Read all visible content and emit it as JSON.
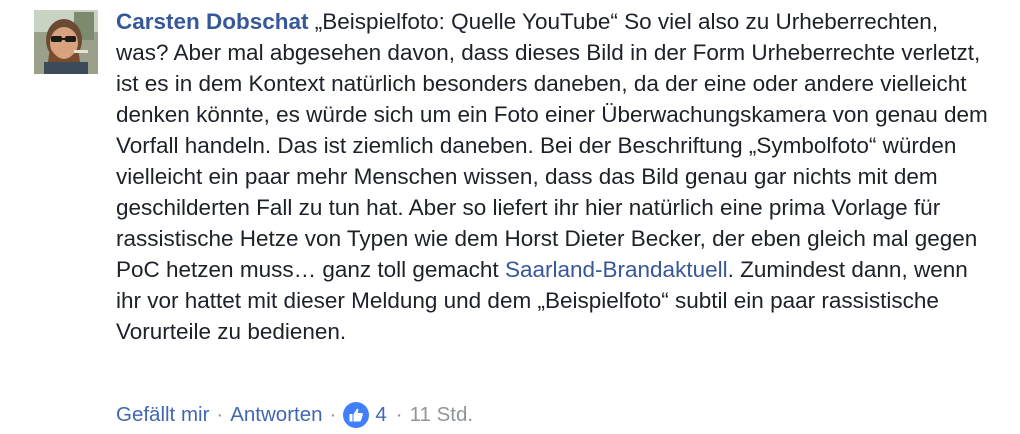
{
  "comment": {
    "author": "Carsten Dobschat",
    "text_before_tag": " „Beispielfoto: Quelle YouTube“ So viel also zu Urheberrechten, was? Aber mal abgesehen davon, dass dieses Bild in der Form Urheberrechte verletzt, ist es in dem Kontext natürlich besonders daneben, da der eine oder andere vielleicht denken könnte, es würde sich um ein Foto einer Überwachungskamera von genau dem Vorfall handeln. Das ist ziemlich daneben. Bei der Beschriftung „Symbolfoto“ würden vielleicht ein paar mehr Menschen wissen, dass das Bild genau gar nichts mit dem geschilderten Fall zu tun hat. Aber so liefert ihr hier natürlich eine prima Vorlage für rassistische Hetze von Typen wie dem Horst Dieter Becker, der eben gleich mal gegen PoC hetzen muss… ganz toll gemacht ",
    "tagged_page": "Saarland-Brandaktuell",
    "text_after_tag": ". Zumindest dann, wenn ihr vor hattet mit dieser Meldung und dem „Beispielfoto“ subtil ein paar rassistische Vorurteile zu bedienen."
  },
  "actions": {
    "like": "Gefällt mir",
    "separator": "·",
    "reply": "Antworten",
    "reaction_count": "4",
    "timestamp": "11 Std."
  },
  "icons": {
    "reaction": "thumbs-up-icon",
    "avatar": "profile-photo"
  },
  "colors": {
    "link": "#365899",
    "action_link": "#4267b2",
    "meta": "#90949c",
    "like_badge": "#4080ff",
    "text": "#1d2129"
  }
}
